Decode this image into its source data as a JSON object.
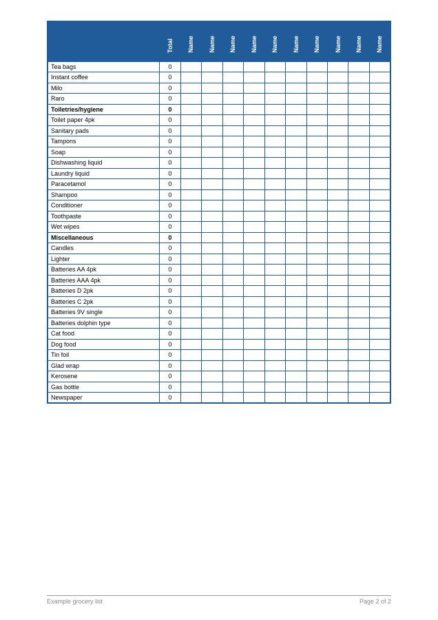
{
  "header": {
    "item_col": "",
    "total_col": "Total",
    "name_cols": [
      "Name",
      "Name",
      "Name",
      "Name",
      "Name",
      "Name",
      "Name",
      "Name",
      "Name",
      "Name"
    ]
  },
  "rows": [
    {
      "label": "Tea bags",
      "total": "0",
      "section": false
    },
    {
      "label": "Instant coffee",
      "total": "0",
      "section": false
    },
    {
      "label": "Milo",
      "total": "0",
      "section": false
    },
    {
      "label": "Raro",
      "total": "0",
      "section": false
    },
    {
      "label": "Toiletries/hygiene",
      "total": "0",
      "section": true
    },
    {
      "label": "Toilet paper 4pk",
      "total": "0",
      "section": false
    },
    {
      "label": "Sanitary pads",
      "total": "0",
      "section": false
    },
    {
      "label": "Tampons",
      "total": "0",
      "section": false
    },
    {
      "label": "Soap",
      "total": "0",
      "section": false
    },
    {
      "label": "Dishwashing liquid",
      "total": "0",
      "section": false
    },
    {
      "label": "Laundry liquid",
      "total": "0",
      "section": false
    },
    {
      "label": "Paracetamol",
      "total": "0",
      "section": false
    },
    {
      "label": "Shampoo",
      "total": "0",
      "section": false
    },
    {
      "label": "Conditioner",
      "total": "0",
      "section": false
    },
    {
      "label": "Toothpaste",
      "total": "0",
      "section": false
    },
    {
      "label": "Wet wipes",
      "total": "0",
      "section": false
    },
    {
      "label": "Miscellaneous",
      "total": "0",
      "section": true
    },
    {
      "label": "Candles",
      "total": "0",
      "section": false
    },
    {
      "label": "Lighter",
      "total": "0",
      "section": false
    },
    {
      "label": "Batteries AA 4pk",
      "total": "0",
      "section": false
    },
    {
      "label": "Batteries AAA 4pk",
      "total": "0",
      "section": false
    },
    {
      "label": "Batteries D 2pk",
      "total": "0",
      "section": false
    },
    {
      "label": "Batteries C 2pk",
      "total": "0",
      "section": false
    },
    {
      "label": "Batteries 9V single",
      "total": "0",
      "section": false
    },
    {
      "label": "Batteries dolphin type",
      "total": "0",
      "section": false
    },
    {
      "label": "Cat food",
      "total": "0",
      "section": false
    },
    {
      "label": "Dog food",
      "total": "0",
      "section": false
    },
    {
      "label": "Tin foil",
      "total": "0",
      "section": false
    },
    {
      "label": "Glad wrap",
      "total": "0",
      "section": false
    },
    {
      "label": "Kerosene",
      "total": "0",
      "section": false
    },
    {
      "label": "Gas bottle",
      "total": "0",
      "section": false
    },
    {
      "label": "Newspaper",
      "total": "0",
      "section": false
    }
  ],
  "footer": {
    "left": "Example grocery list",
    "right": "Page 2 of 2"
  }
}
